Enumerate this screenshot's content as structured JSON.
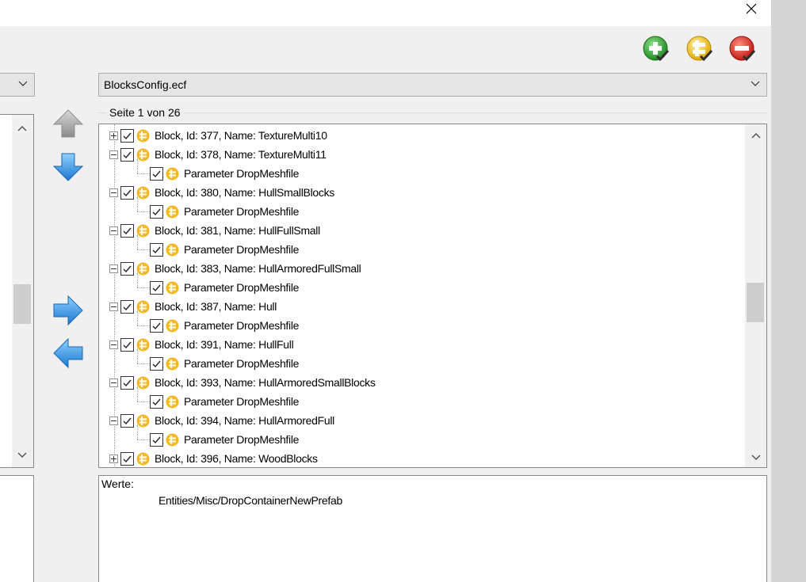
{
  "window": {
    "close_label": "✕"
  },
  "toolbar": {
    "icons": [
      "add-entry-icon",
      "edit-entry-icon",
      "remove-entry-icon"
    ],
    "colors": {
      "add": "#3aa63a",
      "edit": "#f3c623",
      "remove": "#d62a1e"
    }
  },
  "left_panel": {
    "combo_value": ""
  },
  "right_panel": {
    "combo_value": "BlocksConfig.ecf",
    "page_label": "Seite 1 von 26",
    "values_label": "Werte:",
    "values_text": "Entities/Misc/DropContainerNewPrefab"
  },
  "tree": {
    "rows": [
      {
        "level": 0,
        "expander": "plus",
        "checked": true,
        "text": "Block, Id: 377, Name: TextureMulti10"
      },
      {
        "level": 0,
        "expander": "minus",
        "checked": true,
        "text": "Block, Id: 378, Name: TextureMulti11"
      },
      {
        "level": 1,
        "checked": true,
        "text": "Parameter DropMeshfile"
      },
      {
        "level": 0,
        "expander": "minus",
        "checked": true,
        "text": "Block, Id: 380, Name: HullSmallBlocks"
      },
      {
        "level": 1,
        "checked": true,
        "text": "Parameter DropMeshfile"
      },
      {
        "level": 0,
        "expander": "minus",
        "checked": true,
        "text": "Block, Id: 381, Name: HullFullSmall"
      },
      {
        "level": 1,
        "checked": true,
        "text": "Parameter DropMeshfile"
      },
      {
        "level": 0,
        "expander": "minus",
        "checked": true,
        "text": "Block, Id: 383, Name: HullArmoredFullSmall"
      },
      {
        "level": 1,
        "checked": true,
        "text": "Parameter DropMeshfile"
      },
      {
        "level": 0,
        "expander": "minus",
        "checked": true,
        "text": "Block, Id: 387, Name: Hull"
      },
      {
        "level": 1,
        "checked": true,
        "text": "Parameter DropMeshfile"
      },
      {
        "level": 0,
        "expander": "minus",
        "checked": true,
        "text": "Block, Id: 391, Name: HullFull"
      },
      {
        "level": 1,
        "checked": true,
        "text": "Parameter DropMeshfile"
      },
      {
        "level": 0,
        "expander": "minus",
        "checked": true,
        "text": "Block, Id: 393, Name: HullArmoredSmallBlocks"
      },
      {
        "level": 1,
        "checked": true,
        "text": "Parameter DropMeshfile"
      },
      {
        "level": 0,
        "expander": "minus",
        "checked": true,
        "text": "Block, Id: 394, Name: HullArmoredFull"
      },
      {
        "level": 1,
        "checked": true,
        "text": "Parameter DropMeshfile"
      },
      {
        "level": 0,
        "expander": "plus",
        "checked": true,
        "text": "Block, Id: 396, Name: WoodBlocks"
      }
    ]
  },
  "arrows": {
    "up": "arrow-up-icon",
    "down": "arrow-down-icon",
    "right": "arrow-right-icon",
    "left": "arrow-left-icon",
    "colors": {
      "active": "#2a8fe0",
      "disabled": "#a8a8a8"
    }
  }
}
